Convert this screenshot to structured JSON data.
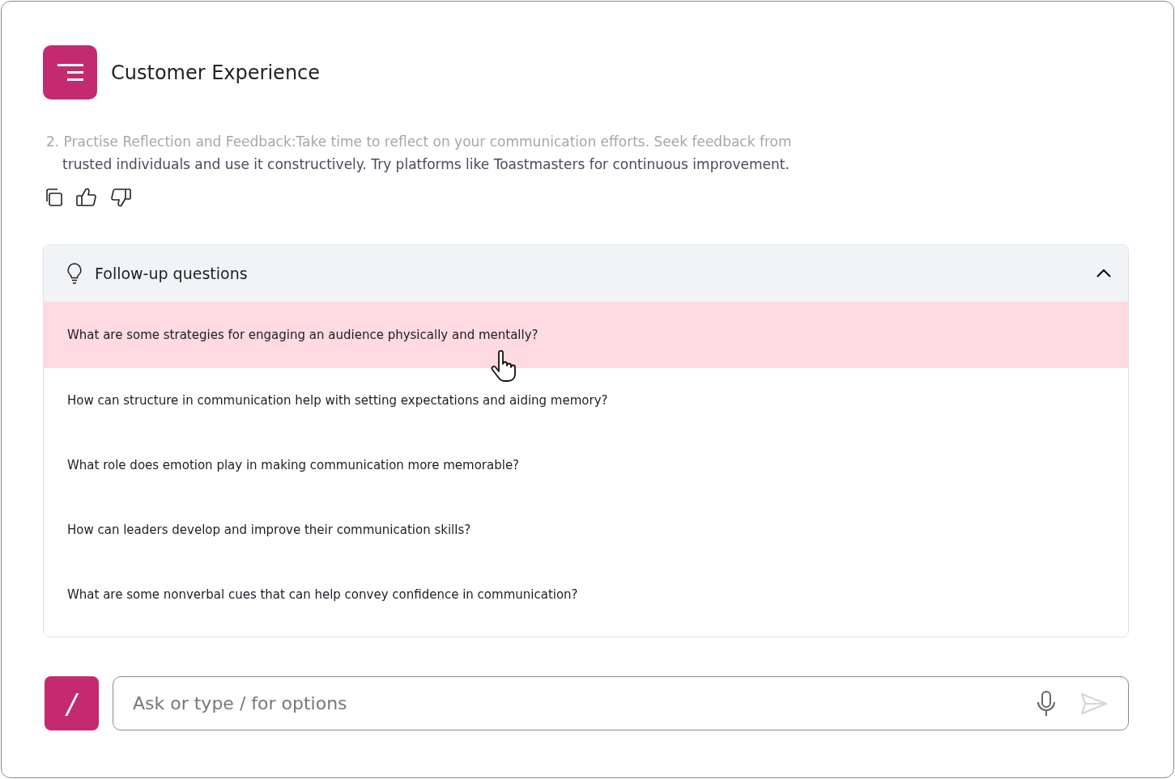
{
  "header": {
    "title": "Customer Experience"
  },
  "answer": {
    "lines": [
      {
        "text": "2. Practise Reflection and Feedback:Take time to reflect on your communication efforts. Seek feedback from",
        "faded": true
      },
      {
        "text": "trusted individuals and use it constructively. Try platforms like Toastmasters for continuous improvement.",
        "faded": false
      }
    ]
  },
  "followups": {
    "title": "Follow-up questions",
    "expanded": true,
    "questions": [
      {
        "text": "What are some strategies for engaging an audience physically and mentally?",
        "highlighted": true
      },
      {
        "text": "How can structure in communication help with setting expectations and aiding memory?",
        "highlighted": false
      },
      {
        "text": "What role does emotion play in making communication more memorable?",
        "highlighted": false
      },
      {
        "text": "How can leaders develop and improve their communication skills?",
        "highlighted": false
      },
      {
        "text": "What are some nonverbal cues that can help convey confidence in communication?",
        "highlighted": false
      }
    ]
  },
  "composer": {
    "command_key": "/",
    "placeholder": "Ask or type / for options"
  }
}
